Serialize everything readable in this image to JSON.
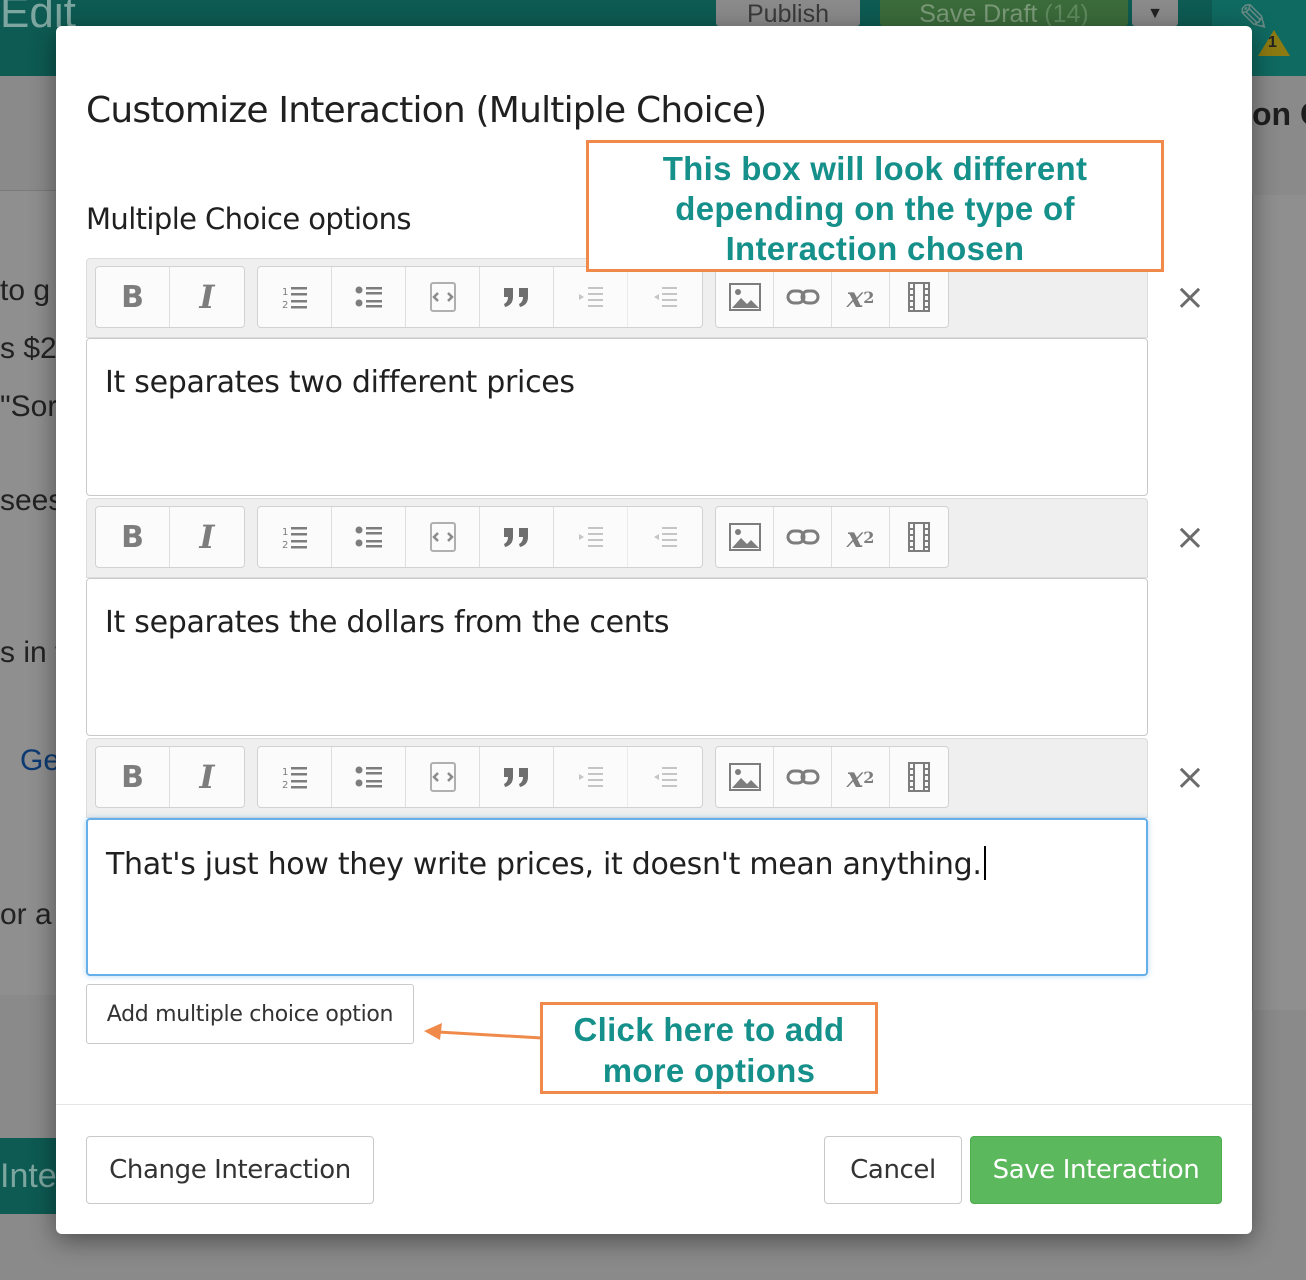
{
  "background": {
    "edit_label": "Edit",
    "publish_label": "Publish",
    "save_draft_label": "Save Draft",
    "save_draft_count": "(14)",
    "warning_count": "1",
    "right_heading_fragment": "on Ov",
    "left_fragments": [
      "to g",
      "s $2",
      "\"Sor",
      "sees",
      "s in t",
      "Ge",
      "or a"
    ],
    "interaction_fragment": "Inte"
  },
  "modal": {
    "title": "Customize Interaction (Multiple Choice)",
    "section_label": "Multiple Choice options",
    "toolbar_icons": [
      "bold-icon",
      "italic-icon",
      "numbered-list-icon",
      "bullet-list-icon",
      "code-block-icon",
      "blockquote-icon",
      "indent-icon",
      "outdent-icon",
      "image-icon",
      "link-icon",
      "superscript-icon",
      "video-icon"
    ],
    "options": [
      {
        "text": "It separates two different prices"
      },
      {
        "text": "It separates the dollars from the cents"
      },
      {
        "text": "That's just how they write prices, it doesn't mean anything."
      }
    ],
    "remove_symbol": "×",
    "add_option_label": "Add multiple choice option",
    "change_interaction_label": "Change Interaction",
    "cancel_label": "Cancel",
    "save_interaction_label": "Save Interaction"
  },
  "annotations": {
    "callout_box_type": "This box will look different depending on the type of Interaction chosen",
    "callout_add_options": "Click here to add more options",
    "border_color": "#f08a4b",
    "text_color": "#16908a"
  },
  "colors": {
    "primary_green": "#5cb85c",
    "focus_blue": "#66afe9",
    "topbar_teal": "#0d5b53"
  }
}
